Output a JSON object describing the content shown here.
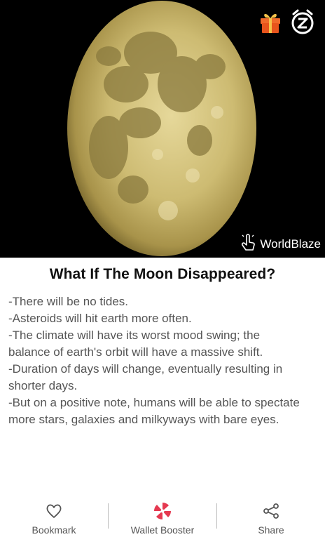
{
  "article": {
    "title": "What If The Moon Disappeared?",
    "lines": [
      "-There will be no tides.",
      "-Asteroids will hit earth more often.",
      "-The climate will have its worst mood swing; the",
      "balance of earth's orbit will have a massive shift.",
      "-Duration of days will change, eventually resulting in",
      "shorter days.",
      "-But on a positive note, humans will be able to spectate",
      "more stars, galaxies and milkyways with bare eyes."
    ]
  },
  "hero": {
    "source_label": "WorldBlaze",
    "source_icon": "tap-hand-icon",
    "gift_icon": "gift-icon",
    "snooze_icon": "snooze-alarm-icon",
    "colors": {
      "background": "#000000",
      "gift": "#e8541c",
      "snooze": "#ffffff"
    }
  },
  "bottom_bar": {
    "items": [
      {
        "label": "Bookmark",
        "icon": "heart-icon"
      },
      {
        "label": "Wallet Booster",
        "icon": "pinwheel-icon",
        "icon_color": "#e53950"
      },
      {
        "label": "Share",
        "icon": "share-icon"
      }
    ]
  }
}
